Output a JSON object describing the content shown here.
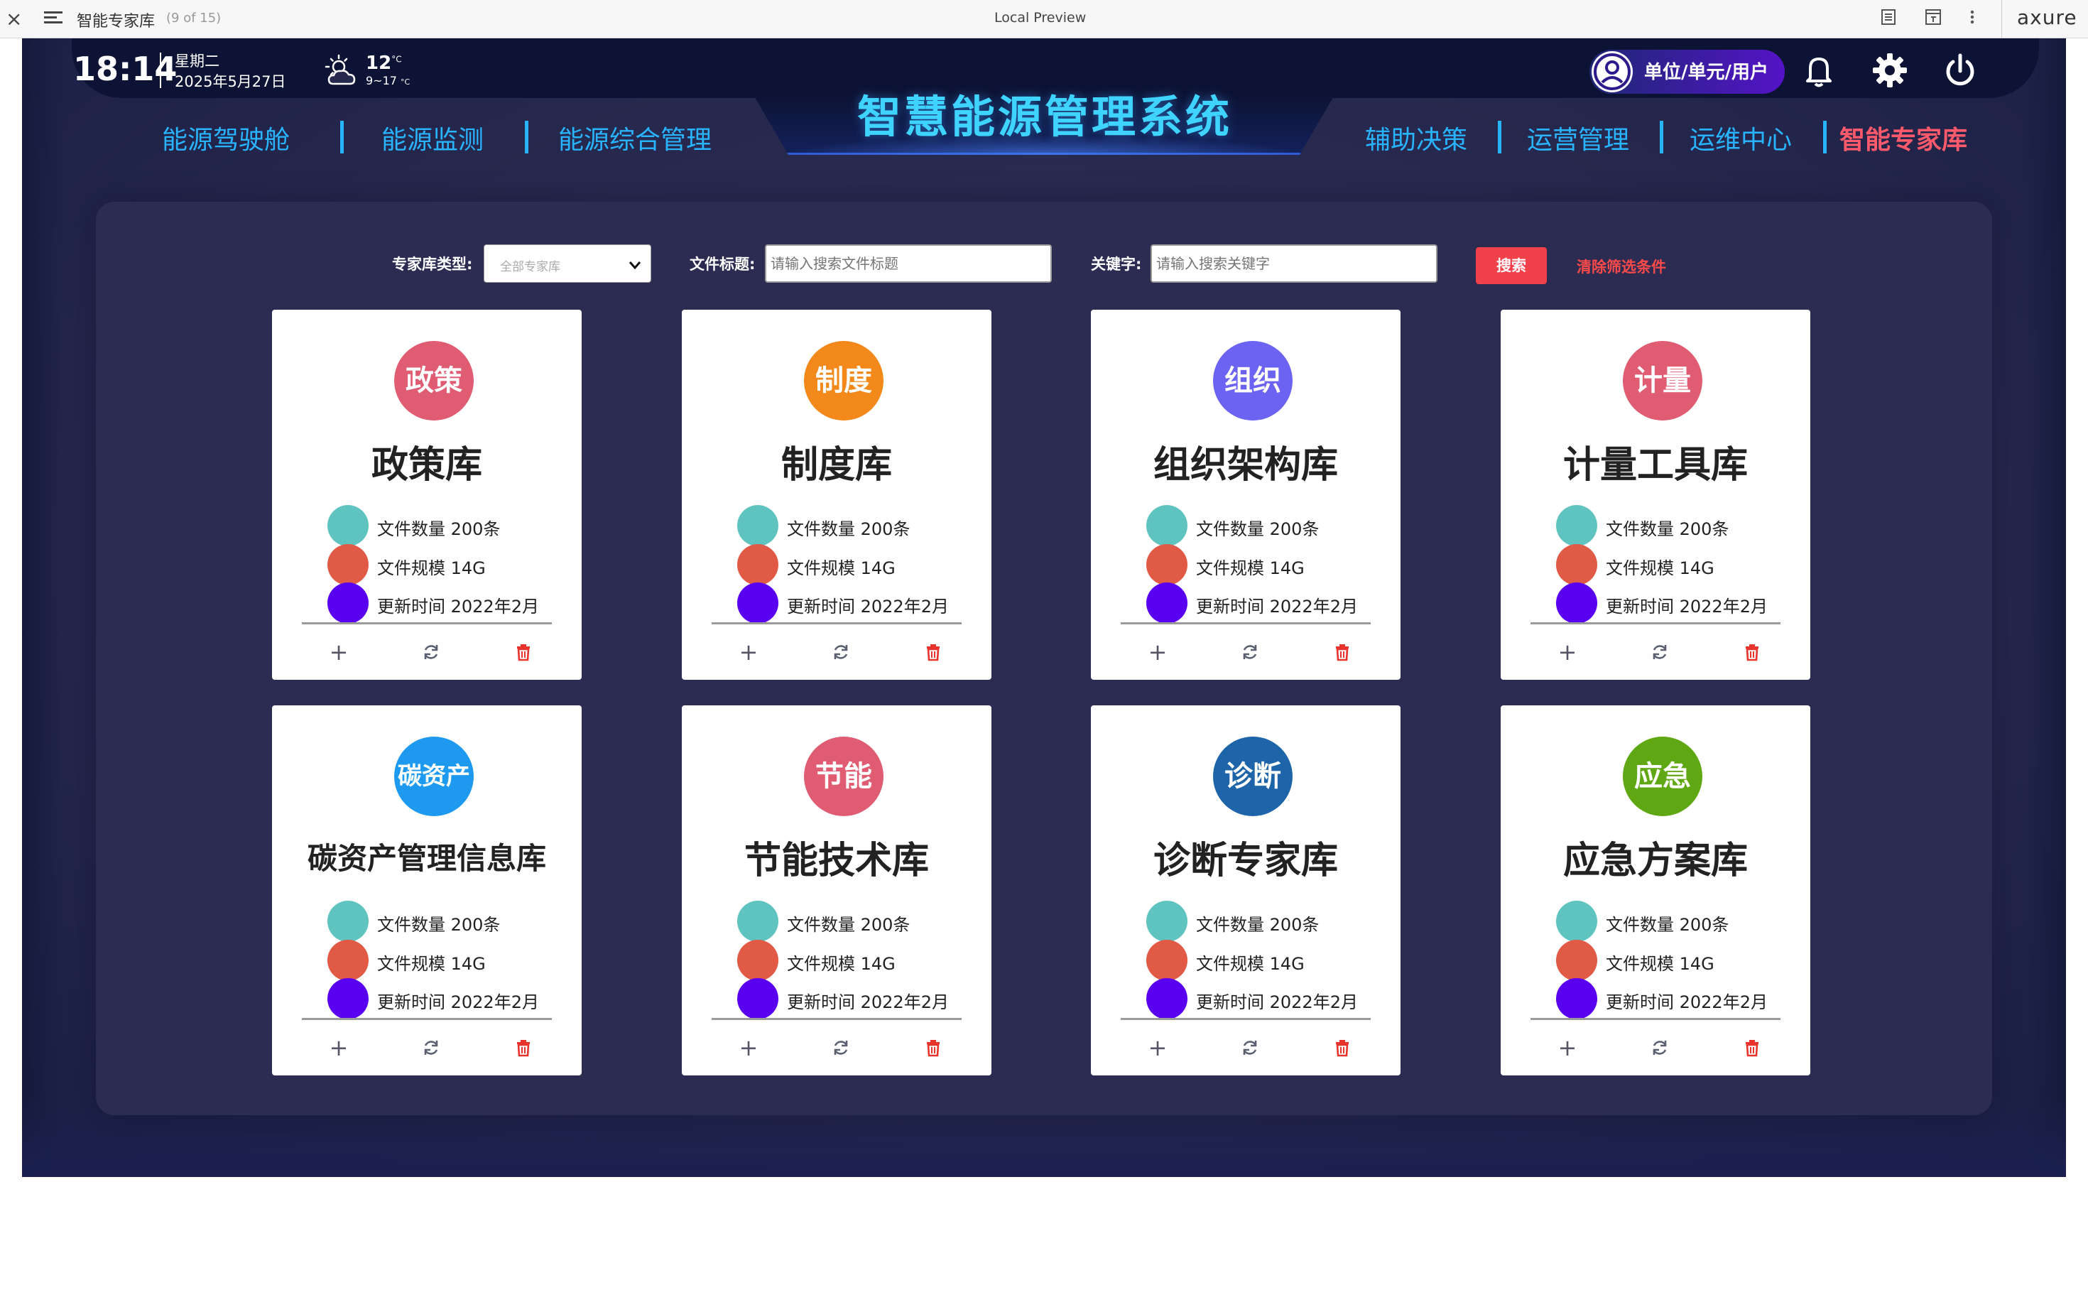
{
  "browser": {
    "page_name": "智能专家库",
    "page_count": "(9 of 15)",
    "preview_label": "Local Preview",
    "brand": "axure",
    "close_icon": "×"
  },
  "header": {
    "time": "18:14",
    "weekday": "星期二",
    "date": "2025年5月27日",
    "temperature": "12",
    "temperature_unit": "°C",
    "temperature_range": "9~17",
    "title": "智慧能源管理系统",
    "user_label": "单位/单元/用户",
    "nav_left": [
      "能源驾驶舱",
      "能源监测",
      "能源综合管理"
    ],
    "nav_right": [
      "辅助决策",
      "运营管理",
      "运维中心",
      "智能专家库"
    ],
    "active_nav": "智能专家库"
  },
  "filters": {
    "type_label": "专家库类型:",
    "type_value": "全部专家库",
    "title_label": "文件标题:",
    "title_placeholder": "请输入搜索文件标题",
    "keyword_label": "关键字:",
    "keyword_placeholder": "请输入搜索关键字",
    "search_label": "搜索",
    "clear_label": "清除筛选条件"
  },
  "cards": [
    {
      "badge": "政策",
      "title": "政策库",
      "badge_color": "#e05c73",
      "count": "文件数量  200条",
      "size": "文件规模 14G",
      "updated": "更新时间 2022年2月"
    },
    {
      "badge": "制度",
      "title": "制度库",
      "badge_color": "#f2891a",
      "count": "文件数量  200条",
      "size": "文件规模 14G",
      "updated": "更新时间 2022年2月"
    },
    {
      "badge": "组织",
      "title": "组织架构库",
      "badge_color": "#6c63f2",
      "count": "文件数量  200条",
      "size": "文件规模 14G",
      "updated": "更新时间 2022年2月"
    },
    {
      "badge": "计量",
      "title": "计量工具库",
      "badge_color": "#e05c73",
      "count": "文件数量  200条",
      "size": "文件规模 14G",
      "updated": "更新时间 2022年2月"
    },
    {
      "badge": "碳资产",
      "title": "碳资产管理信息库",
      "badge_color": "#1d9af0",
      "count": "文件数量  200条",
      "size": "文件规模 14G",
      "updated": "更新时间 2022年2月"
    },
    {
      "badge": "节能",
      "title": "节能技术库",
      "badge_color": "#e05c73",
      "count": "文件数量  200条",
      "size": "文件规模 14G",
      "updated": "更新时间 2022年2月"
    },
    {
      "badge": "诊断",
      "title": "诊断专家库",
      "badge_color": "#1d64a8",
      "count": "文件数量  200条",
      "size": "文件规模 14G",
      "updated": "更新时间 2022年2月"
    },
    {
      "badge": "应急",
      "title": "应急方案库",
      "badge_color": "#5fa814",
      "count": "文件数量  200条",
      "size": "文件规模 14G",
      "updated": "更新时间 2022年2月"
    }
  ],
  "row_dot_colors": [
    "#5fc4c0",
    "#e05a45",
    "#5a00f0"
  ],
  "card_actions": {
    "add_icon": "+",
    "refresh_icon": "refresh-icon",
    "delete_icon": "trash-icon"
  },
  "colors": {
    "background": "#27284d",
    "accent": "#29b4ff",
    "active_nav": "#ff5a6c",
    "search_button": "#f1414a"
  }
}
